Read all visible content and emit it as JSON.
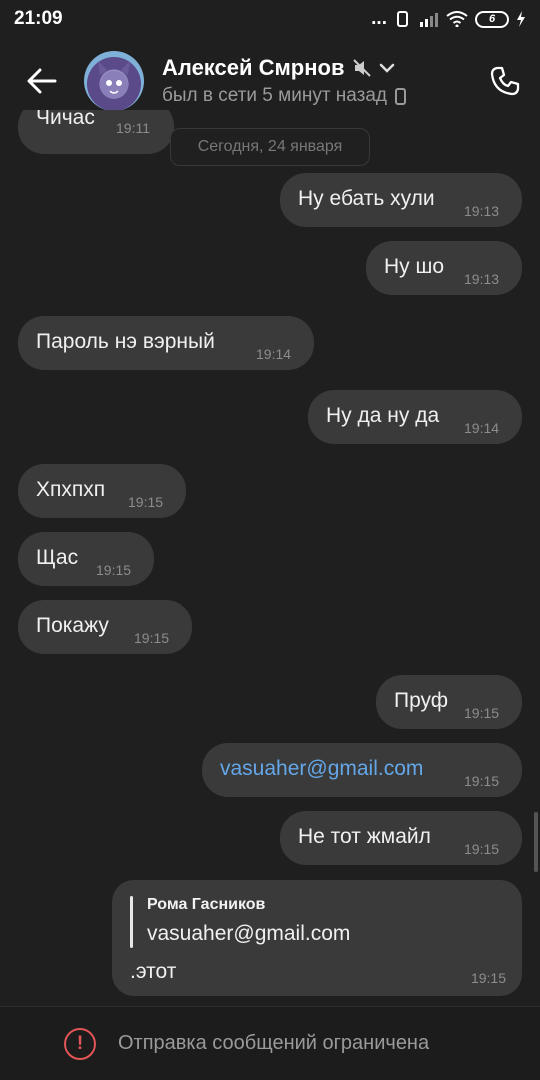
{
  "statusbar": {
    "time": "21:09",
    "dots": "...",
    "battery": "6"
  },
  "header": {
    "name": "Алексей Смрнов",
    "status": "был в сети 5 минут назад"
  },
  "chat": {
    "date_chip": "Сегодня, 24 января",
    "messages": [
      {
        "text": "Чичас",
        "time": "19:11",
        "side": "in"
      },
      {
        "text": "Ну ебать хули",
        "time": "19:13",
        "side": "out"
      },
      {
        "text": "Ну шо",
        "time": "19:13",
        "side": "out"
      },
      {
        "text": "Пароль нэ вэрный",
        "time": "19:14",
        "side": "in"
      },
      {
        "text": "Ну да ну да",
        "time": "19:14",
        "side": "out"
      },
      {
        "text": "Хпхпхп",
        "time": "19:15",
        "side": "in"
      },
      {
        "text": "Щас",
        "time": "19:15",
        "side": "in"
      },
      {
        "text": "Покажу",
        "time": "19:15",
        "side": "in"
      },
      {
        "text": "Пруф",
        "time": "19:15",
        "side": "out"
      },
      {
        "text": "vasuaher@gmail.com",
        "time": "19:15",
        "side": "out"
      },
      {
        "text": "Не тот жмайл",
        "time": "19:15",
        "side": "out"
      }
    ],
    "reply_message": {
      "author": "Рома Гасников",
      "quote": "vasuaher@gmail.com",
      "text": ".этот",
      "time": "19:15"
    }
  },
  "footer": {
    "text": "Отправка сообщений ограничена"
  },
  "colors": {
    "background": "#1f1f1f",
    "bubble": "#3a3a3a",
    "link": "#64a7e8",
    "warning": "#e05555"
  }
}
